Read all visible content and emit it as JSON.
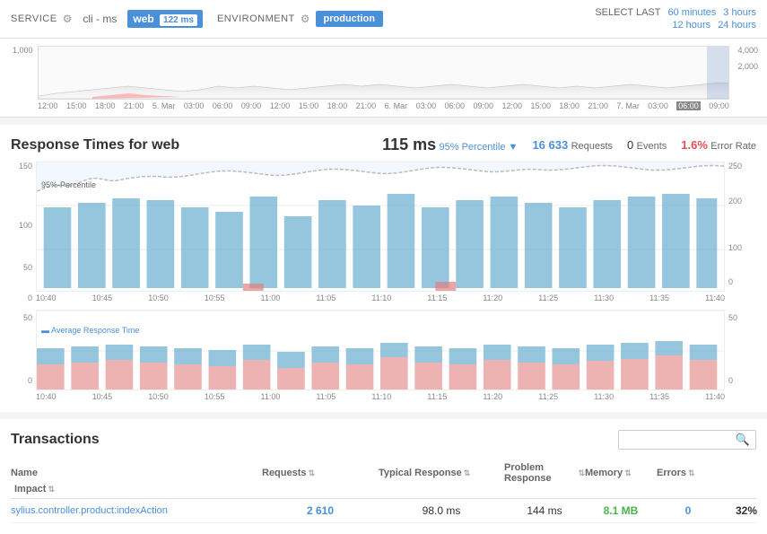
{
  "topbar": {
    "service_label": "SERVICE",
    "service_link1": "cli - ms",
    "service_link2": "web",
    "service_badge": "122 ms",
    "env_label": "ENVIRONMENT",
    "env_value": "production",
    "select_last_label": "SELECT LAST",
    "time_links": [
      "60 minutes",
      "3 hours",
      "12 hours",
      "24 hours"
    ]
  },
  "overview": {
    "y_left_top": "1,000",
    "y_right_top": "4,000",
    "y_right_mid": "2,000",
    "x_labels": [
      "12:00",
      "15:00",
      "18:00",
      "21:00",
      "5. Mar",
      "03:00",
      "06:00",
      "09:00",
      "12:00",
      "15:00",
      "18:00",
      "21:00",
      "6. Mar",
      "03:00",
      "06:00",
      "09:00",
      "12:00",
      "15:00",
      "18:00",
      "21:00",
      "7. Mar",
      "03:00",
      "06:00",
      "09:00"
    ]
  },
  "main_chart": {
    "title": "Response Times for web",
    "ms_value": "115 ms",
    "percentile_label": "95% Percentile",
    "requests_value": "16 633",
    "requests_label": "Requests",
    "events_value": "0",
    "events_label": "Events",
    "error_value": "1.6%",
    "error_label": "Error Rate",
    "y_left_top": "150",
    "y_left_mid": "100",
    "y_left_low": "50",
    "y_right_top": "250",
    "y_right_mid2": "200",
    "y_right_mid": "100",
    "percentile_line_label": "95%-Percentile",
    "avg_line_label": "Average Response Time",
    "x_labels_top": [
      "10:40",
      "10:45",
      "10:50",
      "10:55",
      "11:00",
      "11:05",
      "11:10",
      "11:15",
      "11:20",
      "11:25",
      "11:30",
      "11:35",
      "11:40"
    ],
    "x_labels_bottom": [
      "10:40",
      "10:45",
      "10:50",
      "10:55",
      "11:00",
      "11:05",
      "11:10",
      "11:15",
      "11:20",
      "11:25",
      "11:30",
      "11:35",
      "11:40"
    ]
  },
  "transactions": {
    "title": "Transactions",
    "search_placeholder": "",
    "columns": [
      "Name",
      "Requests",
      "Typical Response",
      "Problem Response",
      "Memory",
      "Errors",
      "Impact"
    ],
    "rows": [
      {
        "name": "sylius.controller.product:indexAction",
        "requests": "2 610",
        "typical_response": "98.0 ms",
        "problem_response": "144 ms",
        "memory": "8.1 MB",
        "errors": "0",
        "impact": "32%"
      }
    ]
  }
}
